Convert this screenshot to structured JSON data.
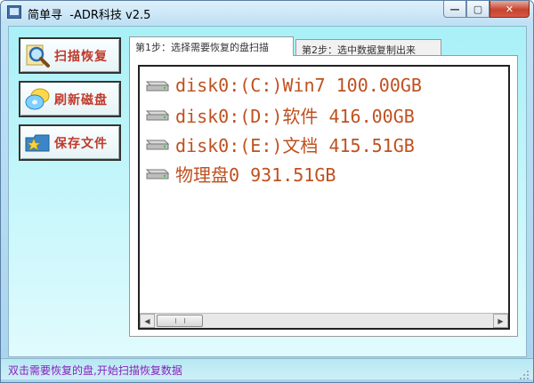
{
  "window": {
    "title": "简单寻  -ADR科技 v2.5",
    "controls": {
      "minimize": "—",
      "maximize": "▢",
      "close": "✕"
    }
  },
  "sidebar": {
    "items": [
      {
        "label": "扫描恢复",
        "icon": "magnifier-icon"
      },
      {
        "label": "刷新磁盘",
        "icon": "disks-icon"
      },
      {
        "label": "保存文件",
        "icon": "folder-star-icon"
      }
    ]
  },
  "tabs": [
    {
      "label": "第1步：选择需要恢复的盘扫描",
      "active": true
    },
    {
      "label": "第2步：选中数据复制出来",
      "active": false
    }
  ],
  "disk_list": [
    {
      "label": "disk0:(C:)Win7 100.00GB",
      "icon": "hard-disk-icon"
    },
    {
      "label": "disk0:(D:)软件 416.00GB",
      "icon": "hard-disk-icon"
    },
    {
      "label": "disk0:(E:)文档 415.51GB",
      "icon": "hard-disk-icon"
    },
    {
      "label": "物理盘0 931.51GB",
      "icon": "hard-disk-icon"
    }
  ],
  "scrollbar": {
    "left_arrow": "◀",
    "right_arrow": "▶"
  },
  "status": {
    "text": "双击需要恢复的盘,开始扫描恢复数据"
  },
  "colors": {
    "disk_text": "#c0501f",
    "button_text": "#c0392b",
    "status_text": "#8a1fbf"
  }
}
